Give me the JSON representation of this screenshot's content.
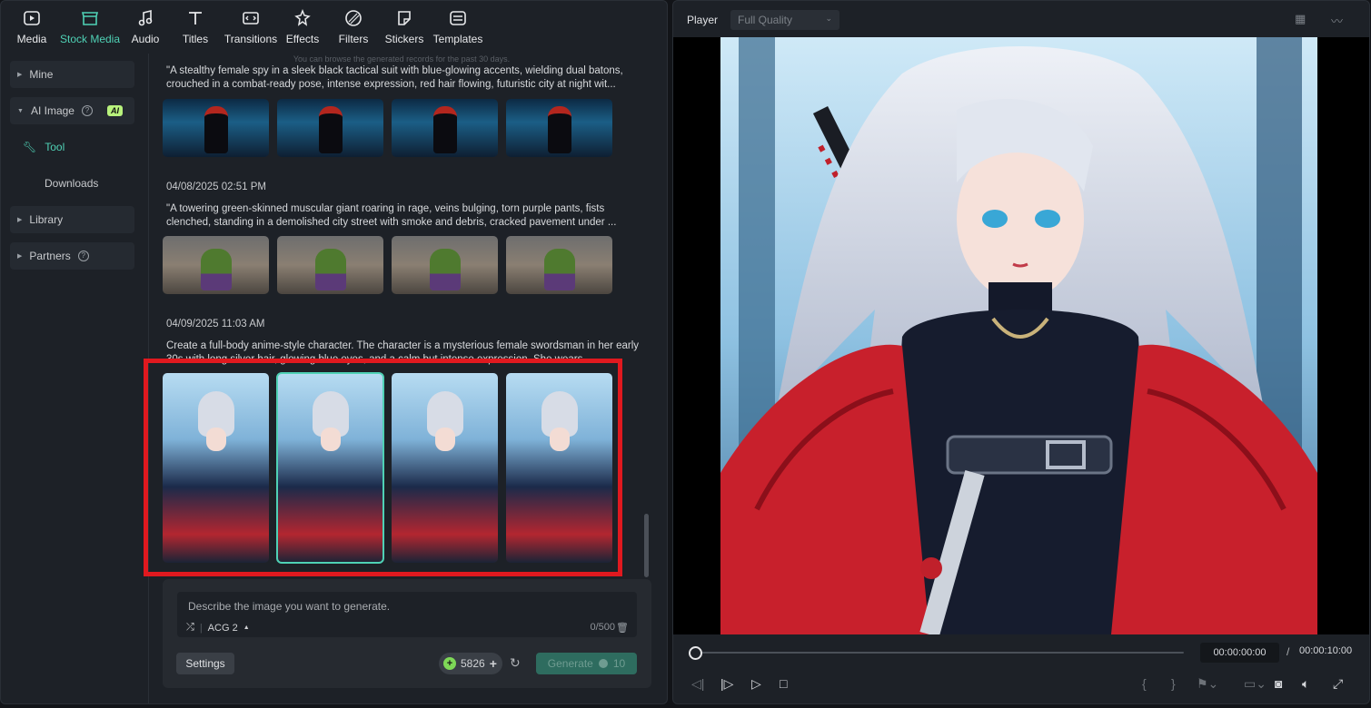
{
  "toolbar": {
    "items": [
      {
        "label": "Media",
        "icon": "media-icon"
      },
      {
        "label": "Stock Media",
        "icon": "stock-media-icon",
        "active": true
      },
      {
        "label": "Audio",
        "icon": "audio-icon"
      },
      {
        "label": "Titles",
        "icon": "titles-icon"
      },
      {
        "label": "Transitions",
        "icon": "transitions-icon"
      },
      {
        "label": "Effects",
        "icon": "effects-icon"
      },
      {
        "label": "Filters",
        "icon": "filters-icon"
      },
      {
        "label": "Stickers",
        "icon": "stickers-icon"
      },
      {
        "label": "Templates",
        "icon": "templates-icon"
      }
    ]
  },
  "sidebar": {
    "mine": "Mine",
    "ai_image": "AI Image",
    "ai_badge": "AI",
    "tool": "Tool",
    "downloads": "Downloads",
    "library": "Library",
    "partners": "Partners"
  },
  "history": {
    "notice": "You can browse the generated records for the past 30 days.",
    "records": [
      {
        "date": "",
        "prompt": "\"A stealthy female spy in a sleek black tactical suit with blue-glowing accents, wielding dual batons, crouched in a combat-ready pose, intense expression, red hair flowing, futuristic city at night wit..."
      },
      {
        "date": "04/08/2025 02:51 PM",
        "prompt": "\"A towering green-skinned muscular giant roaring in rage, veins bulging, torn purple pants, fists clenched, standing in a demolished city street with smoke and debris, cracked pavement under ..."
      },
      {
        "date": "04/09/2025 11:03 AM",
        "prompt": "Create a full-body anime-style character. The character is a mysterious female swordsman in her early 30s with long silver hair, glowing blue eyes, and a calm but intense expression. She wears..."
      }
    ]
  },
  "generator": {
    "placeholder": "Describe the image you want to generate.",
    "model": "ACG 2",
    "counter": "0/500",
    "settings_label": "Settings",
    "credits": "5826",
    "generate_label": "Generate",
    "generate_cost": "10"
  },
  "player": {
    "title": "Player",
    "quality": "Full Quality",
    "current_time": "00:00:00:00",
    "separator": "/",
    "total_time": "00:00:10:00",
    "progress": 0
  },
  "colors": {
    "accent": "#4fd1b5",
    "highlight_box": "#e0191f",
    "ai_badge": "#b8f27c"
  }
}
